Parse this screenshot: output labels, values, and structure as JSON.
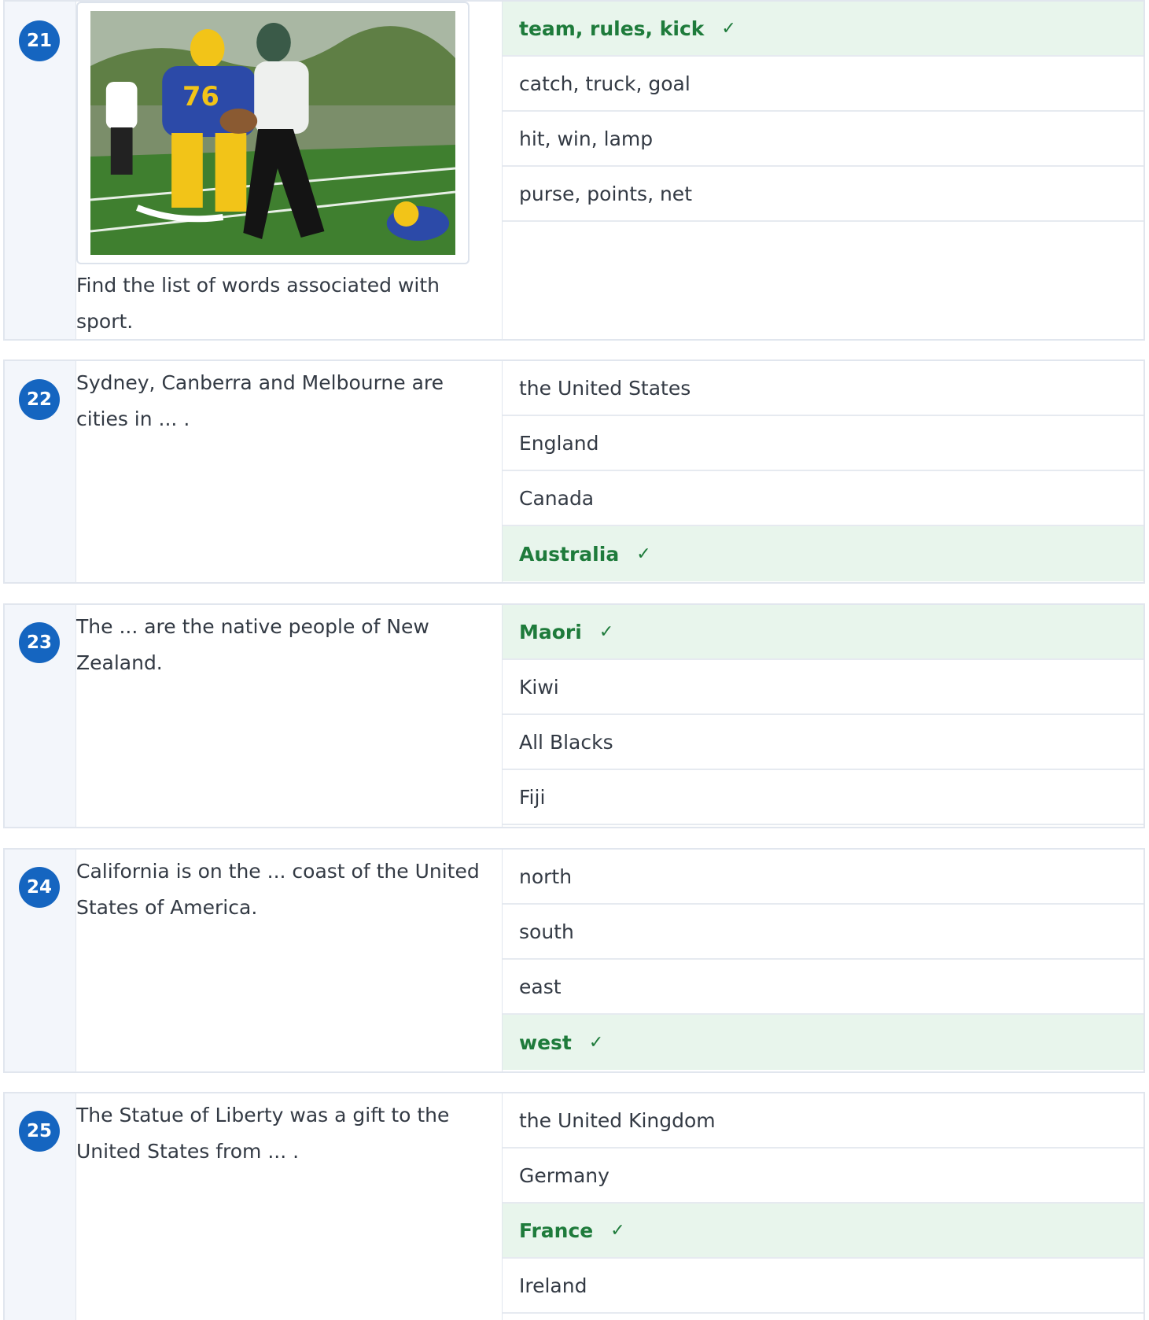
{
  "questions": [
    {
      "number": "21",
      "text": "Find the list of words associated with sport.",
      "image": "football-players-photo",
      "options": [
        "team, rules, kick",
        "catch, truck, goal",
        "hit, win, lamp",
        "purse, points, net"
      ],
      "correct_index": 0
    },
    {
      "number": "22",
      "text": "Sydney, Canberra and Melbourne are cities in ... .",
      "options": [
        "the United States",
        "England",
        "Canada",
        "Australia"
      ],
      "correct_index": 3
    },
    {
      "number": "23",
      "text": "The ... are the native people of New Zealand.",
      "options": [
        "Maori",
        "Kiwi",
        "All Blacks",
        "Fiji"
      ],
      "correct_index": 0
    },
    {
      "number": "24",
      "text": "California is on the ... coast of the United States of America.",
      "options": [
        "north",
        "south",
        "east",
        "west"
      ],
      "correct_index": 3
    },
    {
      "number": "25",
      "text": "The Statue of Liberty was a gift to the United States from ... .",
      "options": [
        "the United Kingdom",
        "Germany",
        "France",
        "Ireland"
      ],
      "correct_index": 2
    }
  ],
  "check_mark": "✓",
  "colors": {
    "badge": "#1565c0",
    "correct_bg": "#e8f5ec",
    "correct_text": "#1e7b3b"
  }
}
